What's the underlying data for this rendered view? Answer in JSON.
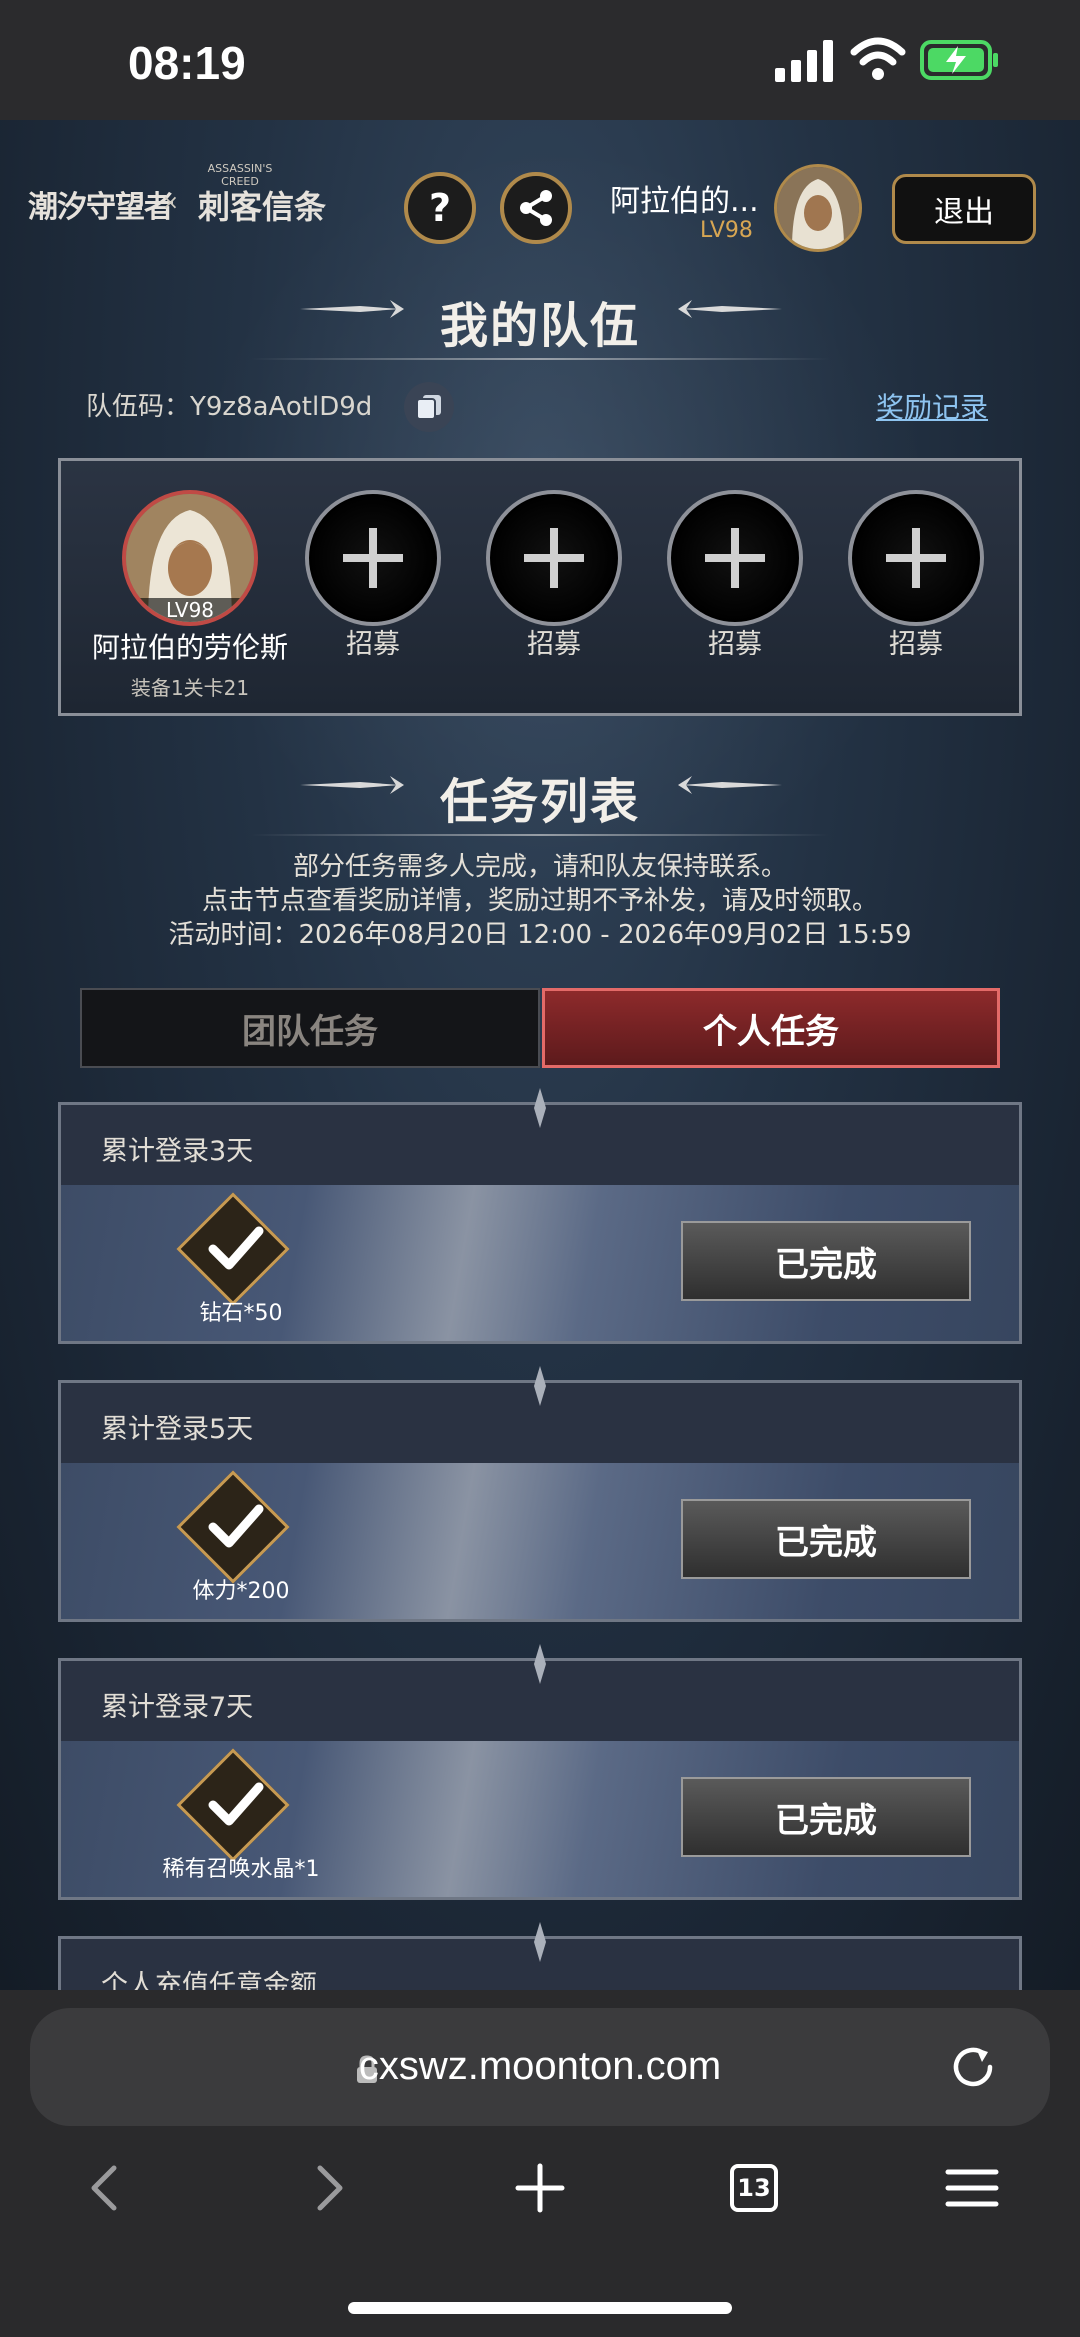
{
  "status": {
    "time": "08:19"
  },
  "header": {
    "logo_left": "潮汐守望者",
    "logo_x": "×",
    "logo_right_small": "ASSASSIN'S CREED",
    "logo_right": "刺客信条",
    "help_icon": "question-icon",
    "share_icon": "share-icon",
    "user_name": "阿拉伯的...",
    "user_level": "LV98",
    "logout_label": "退出"
  },
  "team": {
    "section_title": "我的队伍",
    "code_label": "队伍码：Y9z8aAotlD9d",
    "reward_link": "奖励记录",
    "leader": {
      "level": "LV98",
      "name": "阿拉伯的劳伦斯",
      "sub": "装备1关卡21"
    },
    "slots": [
      {
        "label": "招募"
      },
      {
        "label": "招募"
      },
      {
        "label": "招募"
      },
      {
        "label": "招募"
      }
    ]
  },
  "tasks": {
    "section_title": "任务列表",
    "note1": "部分任务需多人完成，请和队友保持联系。",
    "note2": "点击节点查看奖励详情，奖励过期不予补发，请及时领取。",
    "note3": "活动时间：2026年08月20日 12:00 - 2026年09月02日 15:59",
    "tab_team": "团队任务",
    "tab_self": "个人任务",
    "items": [
      {
        "title": "累计登录3天",
        "reward": "钻石*50",
        "status": "已完成"
      },
      {
        "title": "累计登录5天",
        "reward": "体力*200",
        "status": "已完成"
      },
      {
        "title": "累计登录7天",
        "reward": "稀有召唤水晶*1",
        "status": "已完成"
      },
      {
        "title": "个人充值任意金额"
      }
    ]
  },
  "browser": {
    "url": "cxswz.moonton.com",
    "tabs_count": "13"
  },
  "colors": {
    "accent_gold": "#b08a4b",
    "active_tab_red": "#8d2a2b",
    "link_blue": "#8ec4f0"
  }
}
